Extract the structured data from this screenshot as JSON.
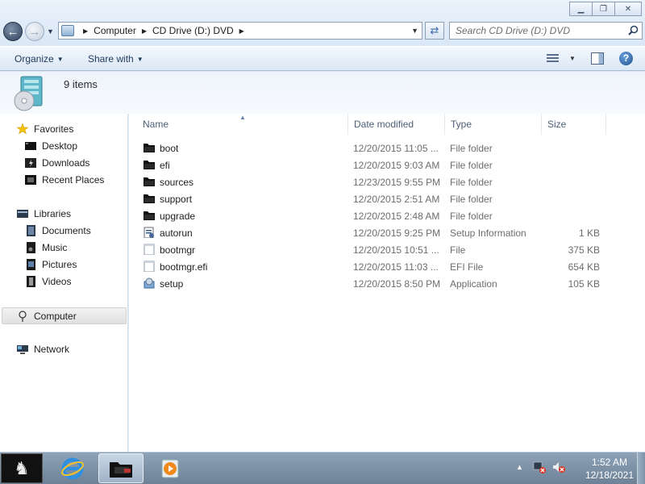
{
  "window": {
    "minimize_glyph": "▁",
    "restore_glyph": "❐",
    "close_glyph": "✕"
  },
  "address_bar": {
    "segments": [
      "Computer",
      "CD Drive (D:) DVD"
    ],
    "search_placeholder": "Search CD Drive (D:) DVD"
  },
  "toolbar": {
    "organize_label": "Organize",
    "share_label": "Share with"
  },
  "details": {
    "item_count": "9 items"
  },
  "nav_pane": {
    "favorites": "Favorites",
    "desktop": "Desktop",
    "downloads": "Downloads",
    "recent_places": "Recent Places",
    "libraries": "Libraries",
    "documents": "Documents",
    "music": "Music",
    "pictures": "Pictures",
    "videos": "Videos",
    "computer": "Computer",
    "network": "Network"
  },
  "columns": {
    "name": "Name",
    "date": "Date modified",
    "type": "Type",
    "size": "Size"
  },
  "files": [
    {
      "name": "boot",
      "date": "12/20/2015 11:05 ...",
      "type": "File folder",
      "size": "",
      "icon": "folder-icon"
    },
    {
      "name": "efi",
      "date": "12/20/2015 9:03 AM",
      "type": "File folder",
      "size": "",
      "icon": "folder-icon"
    },
    {
      "name": "sources",
      "date": "12/23/2015 9:55 PM",
      "type": "File folder",
      "size": "",
      "icon": "folder-icon"
    },
    {
      "name": "support",
      "date": "12/20/2015 2:51 AM",
      "type": "File folder",
      "size": "",
      "icon": "folder-icon"
    },
    {
      "name": "upgrade",
      "date": "12/20/2015 2:48 AM",
      "type": "File folder",
      "size": "",
      "icon": "folder-icon"
    },
    {
      "name": "autorun",
      "date": "12/20/2015 9:25 PM",
      "type": "Setup Information",
      "size": "1 KB",
      "icon": "setup-info-icon"
    },
    {
      "name": "bootmgr",
      "date": "12/20/2015 10:51 ...",
      "type": "File",
      "size": "375 KB",
      "icon": "file-icon"
    },
    {
      "name": "bootmgr.efi",
      "date": "12/20/2015 11:03 ...",
      "type": "EFI File",
      "size": "654 KB",
      "icon": "file-icon"
    },
    {
      "name": "setup",
      "date": "12/20/2015 8:50 PM",
      "type": "Application",
      "size": "105 KB",
      "icon": "setup-app-icon"
    }
  ],
  "taskbar": {
    "clock_time": "1:52 AM",
    "clock_date": "12/18/2021"
  },
  "colors": {
    "accent": "#3a6aa8",
    "folder": "#111111"
  }
}
